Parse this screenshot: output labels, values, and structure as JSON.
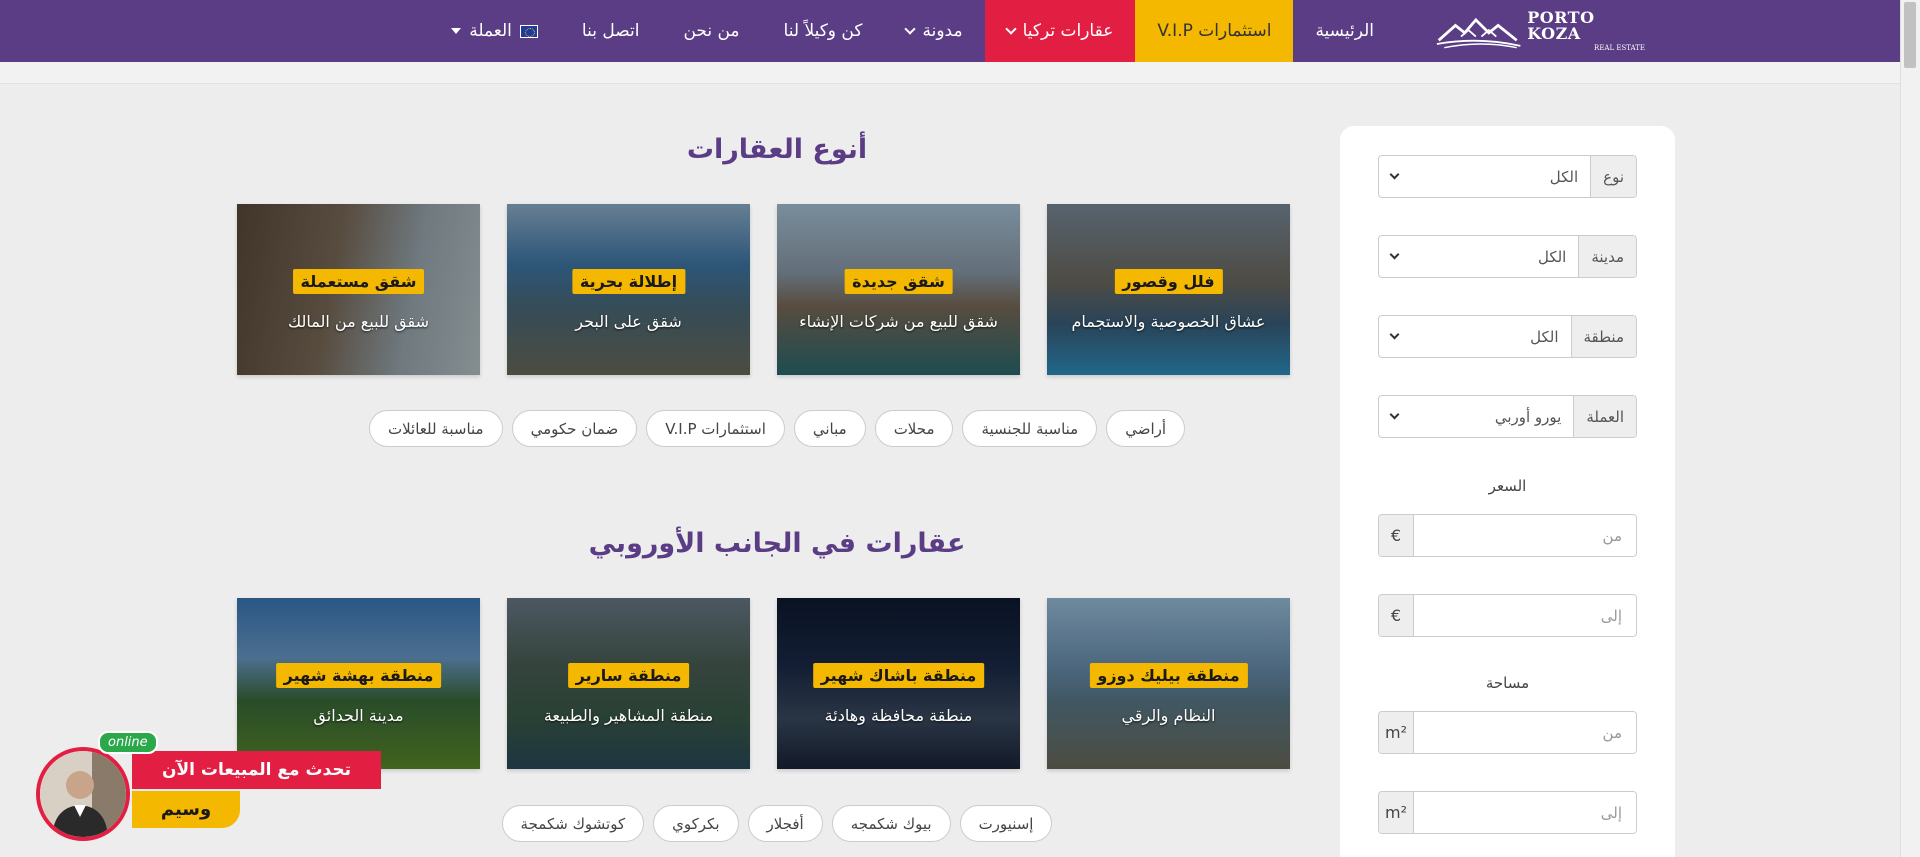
{
  "brand": {
    "name": "PORTO KOZA",
    "tagline": "REAL ESTATE"
  },
  "nav": {
    "home": "الرئيسية",
    "vip": "استثمارات V.I.P",
    "turkey": "عقارات تركيا",
    "blog": "مدونة",
    "agent": "كن وكيلاً لنا",
    "about": "من نحن",
    "contact": "اتصل بنا",
    "currency": "العملة"
  },
  "filter": {
    "type_label": "نوع",
    "type_value": "الكل",
    "city_label": "مدينة",
    "city_value": "الكل",
    "area_label": "منطقة",
    "area_value": "الكل",
    "currency_label": "العملة",
    "currency_value": "يورو أوربي",
    "price_label": "السعر",
    "price_from_placeholder": "من",
    "price_to_placeholder": "إلى",
    "price_unit": "€",
    "size_label": "مساحة",
    "size_from_placeholder": "من",
    "size_to_placeholder": "إلى",
    "size_unit": "m²"
  },
  "types": {
    "title": "أنوع العقارات",
    "cards": [
      {
        "badge": "فلل وقصور",
        "sub": "عشاق الخصوصية والاستجمام"
      },
      {
        "badge": "شقق جديدة",
        "sub": "شقق للبيع من شركات الإنشاء"
      },
      {
        "badge": "إطلالة بحرية",
        "sub": "شقق على البحر"
      },
      {
        "badge": "شقق مستعملة",
        "sub": "شقق للبيع من المالك"
      }
    ],
    "chips": [
      "أراضي",
      "مناسبة للجنسية",
      "محلات",
      "مباني",
      "استثمارات V.I.P",
      "ضمان حكومي",
      "مناسبة للعائلات"
    ]
  },
  "european": {
    "title": "عقارات في الجانب الأوروبي",
    "cards": [
      {
        "badge": "منطقة بيليك دوزو",
        "sub": "النظام والرقي"
      },
      {
        "badge": "منطقة باشاك شهير",
        "sub": "منطقة محافظة وهادئة"
      },
      {
        "badge": "منطقة سارير",
        "sub": "منطقة المشاهير والطبيعة"
      },
      {
        "badge": "منطقة بهشة شهير",
        "sub": "مدينة الحدائق"
      }
    ],
    "chips": [
      "إسنيورت",
      "بيوك شكمجه",
      "أفجلار",
      "بكركوي",
      "كوتشوك شكمجة"
    ]
  },
  "chat": {
    "status": "online",
    "title": "تحدث مع المبيعات الآن",
    "name": "وسيم"
  },
  "colors": {
    "brand_purple": "#5a3d85",
    "accent_yellow": "#f5b800",
    "accent_red": "#e31e43"
  }
}
